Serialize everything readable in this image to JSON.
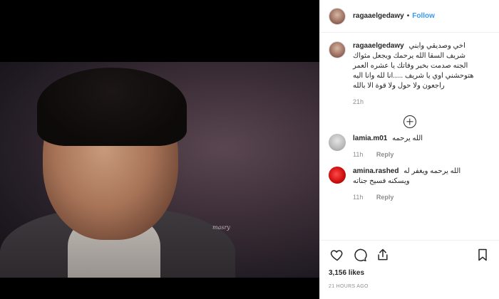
{
  "post": {
    "username": "ragaaelgedawy",
    "separator": "•",
    "follow_label": "Follow",
    "watermark": "masry",
    "caption": {
      "username": "ragaaelgedawy",
      "lines": [
        "اخي وصديقي وابني",
        "شريف السقا الله يرحمك ويجعل مثواك",
        "الجنه صدمت بخبر وفاتك يا عشره العمر",
        "هتوحشني اوي يا شريف .....انا لله وانا اليه",
        "راجعون ولا حول ولا قوة الا بالله"
      ],
      "time": "21h"
    },
    "comments": [
      {
        "username": "lamia.m01",
        "text": "الله يرحمه",
        "time": "11h",
        "reply_label": "Reply"
      },
      {
        "username": "amina.rashed",
        "text_lines": [
          "الله يرحمه ويغفر له",
          "ويسكنه فسيح جناته"
        ],
        "time": "11h",
        "reply_label": "Reply"
      }
    ],
    "likes": "3,156 likes",
    "timestamp": "21 HOURS AGO",
    "icons": [
      "heart-icon",
      "comment-icon",
      "share-icon",
      "bookmark-icon",
      "load-more-plus-icon"
    ]
  }
}
